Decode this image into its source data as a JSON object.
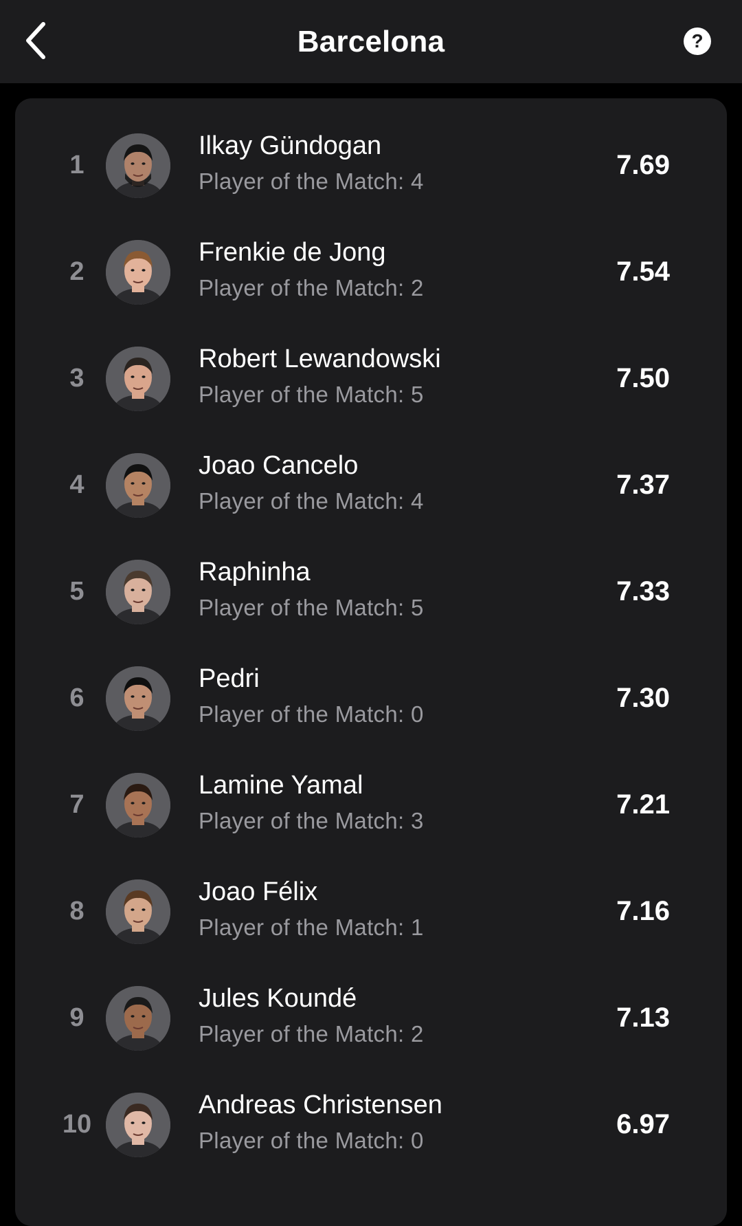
{
  "header": {
    "title": "Barcelona",
    "back_icon": "chevron-left-icon",
    "help_icon": "question-circle-icon",
    "help_label": "?"
  },
  "colors": {
    "background": "#000000",
    "surface": "#1c1c1e",
    "primary_text": "#ffffff",
    "secondary_text": "#9a9a9f",
    "rank_text": "#8e8e93"
  },
  "players": [
    {
      "rank": "1",
      "name": "Ilkay Gündogan",
      "potm": "Player of the Match: 4",
      "rating": "7.69",
      "avatar": {
        "skin": "#b0826a",
        "hair": "#151515",
        "beard": true
      }
    },
    {
      "rank": "2",
      "name": "Frenkie de Jong",
      "potm": "Player of the Match: 2",
      "rating": "7.54",
      "avatar": {
        "skin": "#e2b29a",
        "hair": "#8a5a33",
        "beard": false
      }
    },
    {
      "rank": "3",
      "name": "Robert Lewandowski",
      "potm": "Player of the Match: 5",
      "rating": "7.50",
      "avatar": {
        "skin": "#d9a58c",
        "hair": "#2a2420",
        "beard": false
      }
    },
    {
      "rank": "4",
      "name": "Joao Cancelo",
      "potm": "Player of the Match: 4",
      "rating": "7.37",
      "avatar": {
        "skin": "#b58363",
        "hair": "#111111",
        "beard": false
      }
    },
    {
      "rank": "5",
      "name": "Raphinha",
      "potm": "Player of the Match: 5",
      "rating": "7.33",
      "avatar": {
        "skin": "#d8b09c",
        "hair": "#4a3a2e",
        "beard": false
      }
    },
    {
      "rank": "6",
      "name": "Pedri",
      "potm": "Player of the Match: 0",
      "rating": "7.30",
      "avatar": {
        "skin": "#c08f74",
        "hair": "#0f0f0f",
        "beard": false
      }
    },
    {
      "rank": "7",
      "name": "Lamine Yamal",
      "potm": "Player of the Match: 3",
      "rating": "7.21",
      "avatar": {
        "skin": "#a87355",
        "hair": "#2a1a12",
        "beard": false
      }
    },
    {
      "rank": "8",
      "name": "Joao Félix",
      "potm": "Player of the Match: 1",
      "rating": "7.16",
      "avatar": {
        "skin": "#d3a68a",
        "hair": "#5a3a22",
        "beard": false
      }
    },
    {
      "rank": "9",
      "name": "Jules Koundé",
      "potm": "Player of the Match: 2",
      "rating": "7.13",
      "avatar": {
        "skin": "#9c6a4c",
        "hair": "#1a1a1a",
        "beard": false
      }
    },
    {
      "rank": "10",
      "name": "Andreas Christensen",
      "potm": "Player of the Match: 0",
      "rating": "6.97",
      "avatar": {
        "skin": "#e0b8a6",
        "hair": "#3a2a22",
        "beard": false
      }
    }
  ]
}
